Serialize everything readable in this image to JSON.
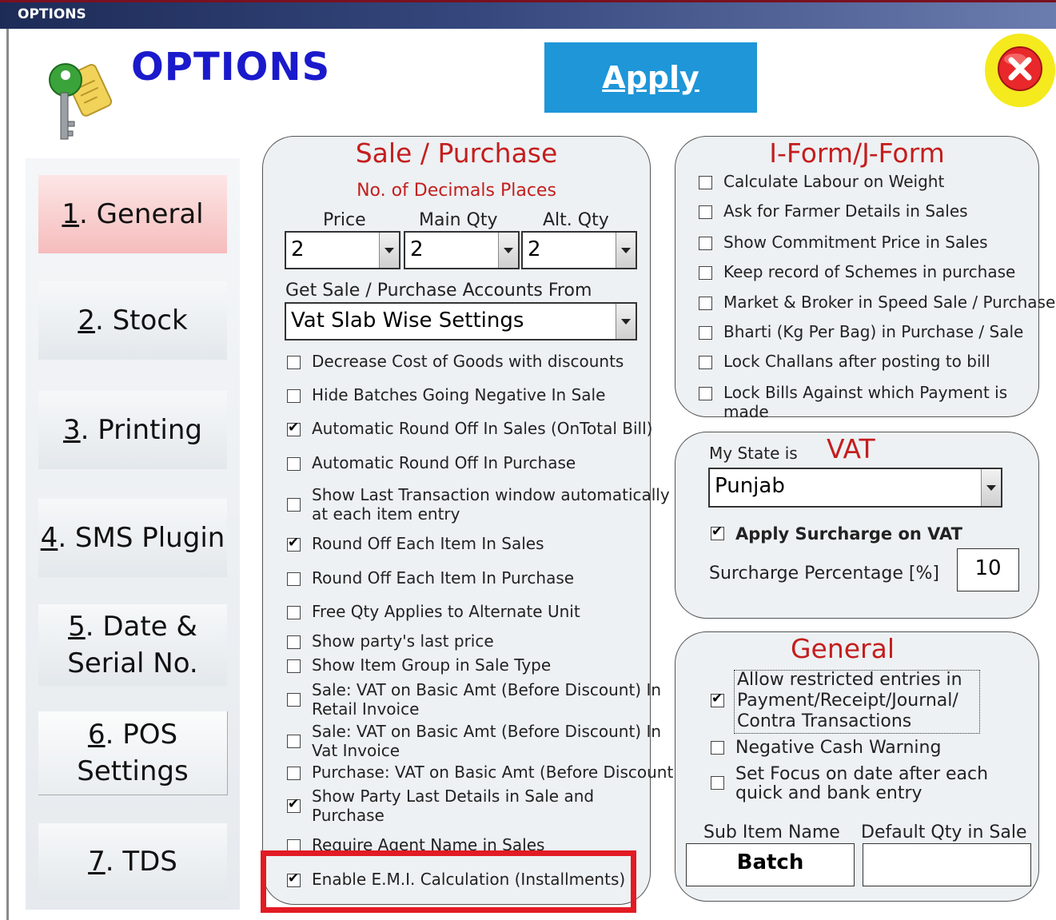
{
  "window": {
    "title": "OPTIONS"
  },
  "header": {
    "heading": "OPTIONS",
    "apply_label": "Apply"
  },
  "tabs": [
    {
      "key": "1",
      "rest": ". General"
    },
    {
      "key": "2",
      "rest": ". Stock"
    },
    {
      "key": "3",
      "rest": ". Printing"
    },
    {
      "key": "4",
      "rest": ". SMS Plugin"
    },
    {
      "key": "5",
      "rest": ". Date &",
      "line2": "Serial No."
    },
    {
      "key": "6",
      "rest": ". POS",
      "line2": "Settings"
    },
    {
      "key": "7",
      "rest": ". TDS"
    }
  ],
  "sale_purchase": {
    "title": "Sale / Purchase",
    "decimals_label": "No. of Decimals Places",
    "price_label": "Price",
    "main_qty_label": "Main Qty",
    "alt_qty_label": "Alt. Qty",
    "price_value": "2",
    "main_qty_value": "2",
    "alt_qty_value": "2",
    "accounts_label": "Get Sale / Purchase Accounts From",
    "accounts_value": "Vat Slab Wise Settings",
    "options": [
      {
        "label": "Decrease Cost of Goods with discounts",
        "checked": false
      },
      {
        "label": "Hide Batches Going Negative In Sale",
        "checked": false
      },
      {
        "label": "Automatic Round Off In Sales (OnTotal Bill)",
        "checked": true
      },
      {
        "label": "Automatic Round Off In Purchase",
        "checked": false
      },
      {
        "label": "Show Last Transaction window automatically",
        "label2": "at each item entry",
        "checked": false
      },
      {
        "label": "Round Off Each Item In Sales",
        "checked": true
      },
      {
        "label": "Round Off Each Item In Purchase",
        "checked": false
      },
      {
        "label": "Free Qty Applies to Alternate Unit",
        "checked": false
      },
      {
        "label": "Show party's last price",
        "checked": false
      },
      {
        "label": "Show Item Group in Sale Type",
        "checked": false
      },
      {
        "label": "Sale: VAT on Basic Amt (Before Discount) In",
        "label2": "Retail Invoice",
        "checked": false
      },
      {
        "label": "Sale: VAT on Basic Amt (Before Discount)  In",
        "label2": "Vat Invoice",
        "checked": false
      },
      {
        "label": "Purchase: VAT on Basic Amt (Before Discount)",
        "checked": false
      },
      {
        "label": "Show Party Last Details in Sale and",
        "label2": "Purchase",
        "checked": true
      },
      {
        "label": "Require Agent Name in Sales",
        "checked": false
      },
      {
        "label": "Enable E.M.I. Calculation (Installments)",
        "checked": true
      }
    ]
  },
  "iform": {
    "title": "I-Form/J-Form",
    "options": [
      {
        "label": "Calculate Labour on Weight",
        "checked": false
      },
      {
        "label": "Ask for Farmer Details in Sales",
        "checked": false
      },
      {
        "label": "Show Commitment Price in Sales",
        "checked": false
      },
      {
        "label": "Keep record of Schemes in purchase",
        "checked": false
      },
      {
        "label": "Market & Broker in Speed Sale / Purchase",
        "checked": false
      },
      {
        "label": "Bharti (Kg Per Bag) in Purchase / Sale",
        "checked": false
      },
      {
        "label": "Lock Challans after posting to bill",
        "checked": false
      },
      {
        "label": "Lock Bills Against which Payment is made",
        "checked": false
      }
    ]
  },
  "vat": {
    "title": "VAT",
    "state_label": "My State is",
    "state_value": "Punjab",
    "surcharge_check_label": "Apply Surcharge on VAT",
    "surcharge_checked": true,
    "surcharge_pct_label": "Surcharge Percentage [%]",
    "surcharge_pct_value": "10"
  },
  "general": {
    "title": "General",
    "restricted_lines": [
      "Allow restricted entries in",
      "Payment/Receipt/Journal/",
      "Contra Transactions"
    ],
    "restricted_checked": true,
    "negative_cash_label": "Negative Cash Warning",
    "negative_cash_checked": false,
    "focus_label": "Set Focus on date after each",
    "focus_label2": "quick and bank entry",
    "focus_checked": false,
    "sub_item_label": "Sub Item Name",
    "sub_item_value": "Batch",
    "default_qty_label": "Default Qty in Sale",
    "default_qty_value": ""
  },
  "colors": {
    "accent_red": "#c41e1e",
    "apply_blue": "#1e96d8",
    "heading_blue": "#1a1acc",
    "highlight": "#e21b24"
  }
}
